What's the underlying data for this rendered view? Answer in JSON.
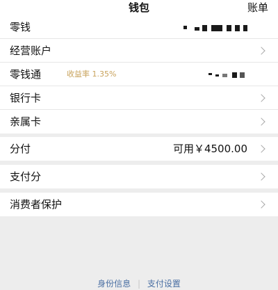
{
  "header": {
    "title": "钱包",
    "right_label": "账单"
  },
  "groups": [
    {
      "rows": [
        {
          "label": "零钱",
          "value_masked": true
        },
        {
          "label": "经营账户"
        },
        {
          "label": "零钱通",
          "sub": "收益率 1.35%",
          "value_masked": true
        },
        {
          "label": "银行卡"
        },
        {
          "label": "亲属卡"
        }
      ]
    },
    {
      "rows": [
        {
          "label": "分付",
          "value": "可用￥4500.00"
        }
      ]
    },
    {
      "rows": [
        {
          "label": "支付分"
        }
      ]
    },
    {
      "rows": [
        {
          "label": "消费者保护"
        }
      ]
    }
  ],
  "footer": {
    "link1": "身份信息",
    "separator": "|",
    "link2": "支付设置"
  },
  "colors": {
    "background": "#ededed",
    "rate_text": "#c8a25b",
    "footer_link": "#4a6fa3",
    "chevron": "#a8a8a8"
  },
  "icons": [
    "chevron-right-icon"
  ]
}
